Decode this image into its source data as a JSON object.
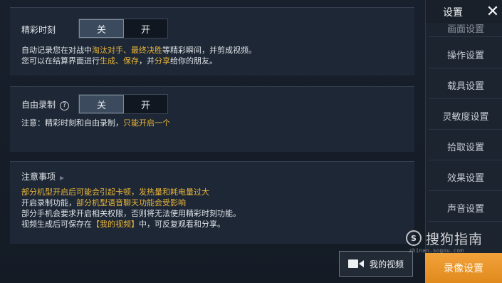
{
  "highlight": {
    "label": "精彩时刻",
    "toggle_off": "关",
    "toggle_on": "开",
    "desc1_a": "自动记录您在对战中",
    "desc1_b": "淘汰对手、最终决胜",
    "desc1_c": "等精彩瞬间，并剪成视频。",
    "desc2_a": "您可以在结算界面进行",
    "desc2_b": "生成、保存",
    "desc2_c": "，并",
    "desc2_d": "分享",
    "desc2_e": "给你的朋友。"
  },
  "free_record": {
    "label": "自由录制",
    "help": "?",
    "toggle_off": "关",
    "toggle_on": "开",
    "note_a": "注意：精彩时刻和自由录制，",
    "note_b": "只能开启一个"
  },
  "notes": {
    "title": "注意事项",
    "line1": "部分机型开启后可能会引起卡顿，发热量和耗电量过大",
    "line2_a": "开启录制功能，",
    "line2_b": "部分机型语音聊天功能会受影响",
    "line3": "部分手机会要求开启相关权限，否则将无法使用精彩时刻功能。",
    "line4_a": "视频生成后可保存在",
    "line4_b": "【我的视频】",
    "line4_c": "中，可反复观看和分享。"
  },
  "my_video_label": "我的视频",
  "sidebar": {
    "title": "设置",
    "close": "✕",
    "items": [
      {
        "label": "画面设置"
      },
      {
        "label": "操作设置"
      },
      {
        "label": "载具设置"
      },
      {
        "label": "灵敏度设置"
      },
      {
        "label": "拾取设置"
      },
      {
        "label": "效果设置"
      },
      {
        "label": "声音设置"
      },
      {
        "label": "录像设置"
      }
    ]
  },
  "watermark": {
    "logo": "S",
    "text": "搜狗指南",
    "url": "zhinan.sogou.com"
  },
  "colors": {
    "highlight": "#e9b53a",
    "active_tab": "#f2a23a"
  }
}
